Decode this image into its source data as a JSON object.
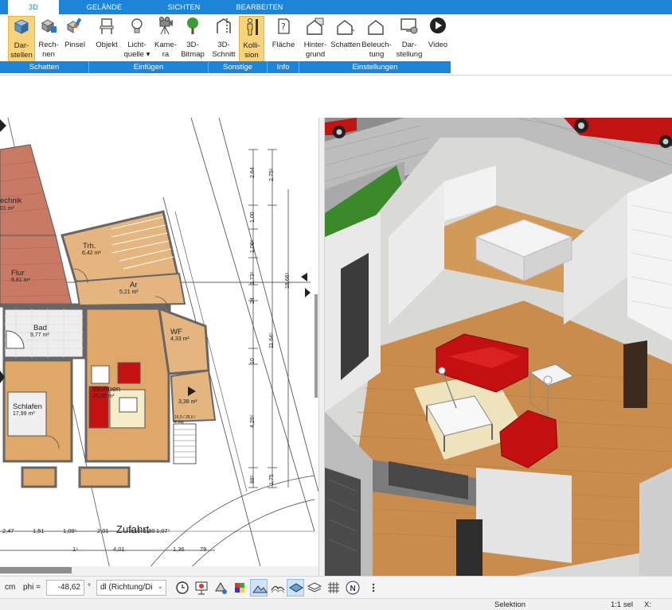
{
  "tabs": [
    {
      "label": "3D"
    },
    {
      "label": "GELÄNDE"
    },
    {
      "label": "SICHTEN"
    },
    {
      "label": "BEARBEITEN"
    }
  ],
  "ribbon": {
    "buttons": [
      {
        "label": "Dar-\nstellen",
        "icon": "cube-icon"
      },
      {
        "label": "Rech-\nnen",
        "icon": "cube-calc-icon"
      },
      {
        "label": "Pinsel",
        "icon": "paint-brush-icon"
      },
      {
        "label": "Objekt",
        "icon": "chair-icon"
      },
      {
        "label": "Licht-\nquelle ▾",
        "icon": "lightbulb-icon"
      },
      {
        "label": "Kame-\nra",
        "icon": "camera-icon"
      },
      {
        "label": "3D-\nBitmap",
        "icon": "tree-icon"
      },
      {
        "label": "3D-\nSchnitt",
        "icon": "section-cut-icon"
      },
      {
        "label": "Kolli-\nsion",
        "icon": "person-collision-icon"
      },
      {
        "label": "Fläche",
        "icon": "area-help-icon"
      },
      {
        "label": "Hinter-\ngrund",
        "icon": "house-background-icon"
      },
      {
        "label": "Schatten",
        "icon": "house-shadow-icon"
      },
      {
        "label": "Beleuch-\ntung",
        "icon": "house-lighting-icon"
      },
      {
        "label": "Dar-\nstellung",
        "icon": "monitor-settings-icon"
      },
      {
        "label": "Video",
        "icon": "play-icon"
      }
    ],
    "groups": [
      "Schatten",
      "Einfügen",
      "Sonstige",
      "Info",
      "Einstellungen"
    ]
  },
  "plan": {
    "rooms": [
      {
        "name": "echnik",
        "area": "01 m²"
      },
      {
        "name": "Trh.",
        "area": "6,42 m²"
      },
      {
        "name": "Flur",
        "area": "9,81 m²"
      },
      {
        "name": "Ar",
        "area": "5,21 m²"
      },
      {
        "name": "Bad",
        "area": "9,77 m²"
      },
      {
        "name": "WF",
        "area": "4,33 m²"
      },
      {
        "name": "Wohnen",
        "area": "25,00 m²"
      },
      {
        "name": "Schlafen",
        "area": "17,99 m²"
      },
      {
        "name": "",
        "area": "3,38 m²"
      }
    ],
    "street_label": "Zufahrt",
    "dims_row1": [
      "2,47",
      "1,51",
      "1,09⁵",
      "2,01",
      "2,16",
      "1,80",
      "1,07⁵"
    ],
    "dims_row2": [
      "1⁵",
      "4,01",
      "1,36",
      "79"
    ],
    "vdims_a": [
      "2,64",
      "1,00",
      "1,06⁵",
      "1,73⁵",
      "24",
      "10",
      "4,29⁵",
      "88⁵"
    ],
    "vdims_b": [
      "2,75⁵",
      "11,64⁵",
      "18,66⁵",
      "1,75"
    ],
    "stair_label": "16,5 / 28,6 / 8 Stg"
  },
  "bottombar": {
    "unit": "cm",
    "phi_label": "phi =",
    "phi_value": "-48,62",
    "degree": "°",
    "dl_value": "dl (Richtung/Di",
    "tools": [
      "clock-icon",
      "presentation-icon",
      "paint-icon",
      "color-picker-icon",
      "terrain-icon",
      "terrain-alt-icon",
      "layers-icon",
      "stack-icon",
      "grid-icon",
      "north-icon",
      "more-icon"
    ]
  },
  "status": {
    "mode": "Selektion",
    "scale": "1:1 sel",
    "x_label": "X:"
  },
  "colors": {
    "ribbon_blue": "#1c85d8",
    "active_orange": "#f9d37a",
    "roof_red": "#c97a64",
    "floor_wood": "#e0a868",
    "sofa_red": "#c40f0f"
  }
}
